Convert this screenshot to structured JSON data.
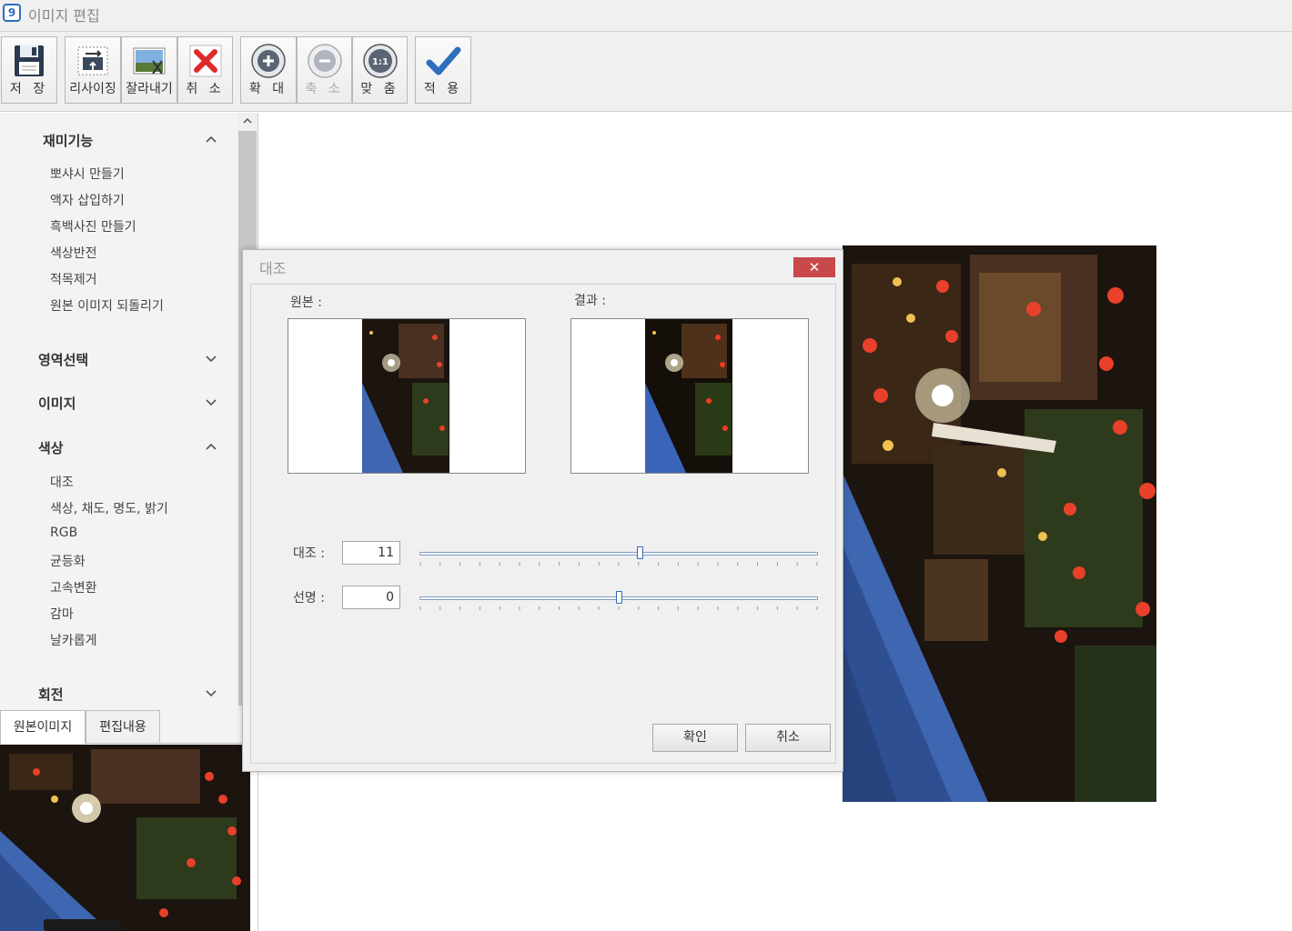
{
  "window": {
    "title": "이미지 편집",
    "icon": "app-icon",
    "icon_glyph": "9"
  },
  "toolbar": {
    "save": "저 장",
    "resize": "리사이징",
    "crop": "잘라내기",
    "cancel": "취 소",
    "zoom_in": "확 대",
    "zoom_out": "축 소",
    "fit": "맞 춤",
    "fit_icon_text": "1:1",
    "apply": "적 용"
  },
  "sidebar": {
    "sections": [
      {
        "title": "재미기능",
        "expanded": true,
        "items": [
          "뽀샤시 만들기",
          "액자 삽입하기",
          "흑백사진 만들기",
          "색상반전",
          "적목제거",
          "원본 이미지 되돌리기"
        ]
      },
      {
        "title": "영역선택",
        "expanded": false,
        "items": []
      },
      {
        "title": "이미지",
        "expanded": false,
        "items": []
      },
      {
        "title": "색상",
        "expanded": true,
        "items": [
          "대조",
          "색상, 채도, 명도, 밝기",
          "RGB",
          "균등화",
          "고속변환",
          "감마",
          "날카롭게"
        ]
      },
      {
        "title": "회전",
        "expanded": false,
        "items": []
      }
    ]
  },
  "tabs": {
    "original": "원본이미지",
    "edit_history": "편집내용"
  },
  "dialog": {
    "title": "대조",
    "close": "✕",
    "original_label": "원본 :",
    "result_label": "결과 :",
    "contrast_label": "대조 :",
    "contrast_value": "11",
    "contrast_fraction": 0.553,
    "sharpness_label": "선명 :",
    "sharpness_value": "0",
    "sharpness_fraction": 0.5,
    "ok": "확인",
    "cancel": "취소"
  },
  "colors": {
    "accent_blue": "#2d6fbd",
    "close_red": "#c7494a",
    "sky": "#3f66b0",
    "night": "#1b140f",
    "lantern": "#e8402a"
  }
}
